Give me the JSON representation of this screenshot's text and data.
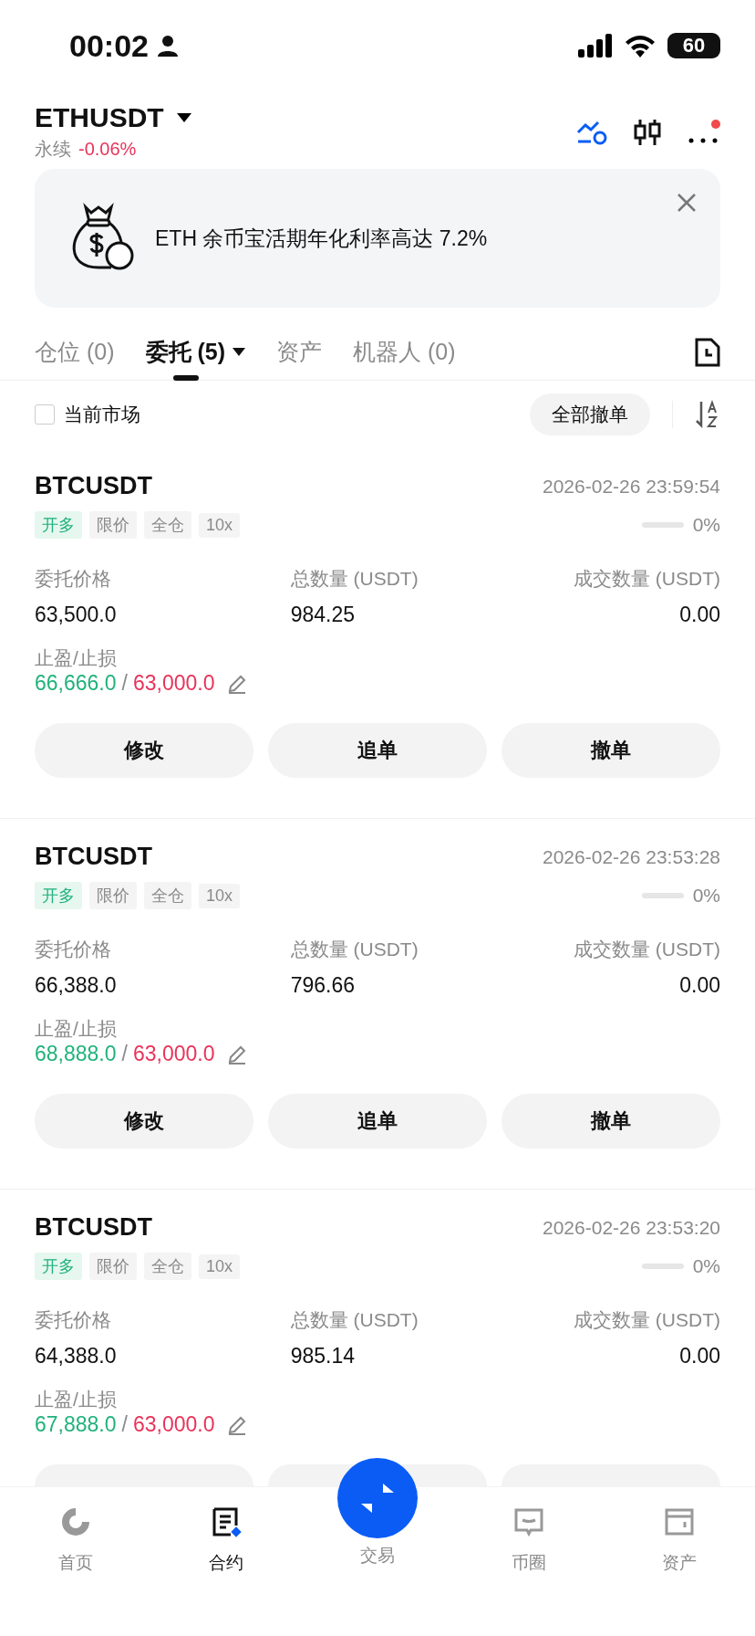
{
  "status_bar": {
    "time": "00:02",
    "battery": "60"
  },
  "header": {
    "symbol": "ETHUSDT",
    "type": "永续",
    "change": "-0.06%",
    "notification_dot": true
  },
  "banner": {
    "text": "ETH 余币宝活期年化利率高达 7.2%"
  },
  "tabs": [
    {
      "label": "仓位 (0)",
      "selected": false,
      "dropdown": false
    },
    {
      "label": "委托 (5)",
      "selected": true,
      "dropdown": true
    },
    {
      "label": "资产",
      "selected": false,
      "dropdown": false
    },
    {
      "label": "机器人 (0)",
      "selected": false,
      "dropdown": false
    }
  ],
  "filter": {
    "label": "当前市场",
    "checked": false,
    "cancel_all": "全部撤单"
  },
  "orders": [
    {
      "symbol": "BTCUSDT",
      "time": "2026-02-26 23:59:54",
      "tags": [
        {
          "label": "开多",
          "kind": "side"
        },
        {
          "label": "限价",
          "kind": "plain"
        },
        {
          "label": "全仓",
          "kind": "plain"
        },
        {
          "label": "10x",
          "kind": "plain"
        }
      ],
      "level": 0,
      "progress": "0%",
      "fields": [
        {
          "label": "委托价格",
          "value": "63,500.0"
        },
        {
          "label": "总数量 (USDT)",
          "value": "984.25"
        },
        {
          "label": "成交数量 (USDT)",
          "value": "0.00"
        }
      ],
      "tpsl_label": "止盈/止损",
      "tp": "66,666.0",
      "separator": "/",
      "sl": "63,000.0",
      "actions": [
        "修改",
        "追单",
        "撤单"
      ]
    },
    {
      "symbol": "BTCUSDT",
      "time": "2026-02-26 23:53:28",
      "tags": [
        {
          "label": "开多",
          "kind": "side"
        },
        {
          "label": "限价",
          "kind": "plain"
        },
        {
          "label": "全仓",
          "kind": "plain"
        },
        {
          "label": "10x",
          "kind": "plain"
        }
      ],
      "level": 0,
      "progress": "0%",
      "fields": [
        {
          "label": "委托价格",
          "value": "66,388.0"
        },
        {
          "label": "总数量 (USDT)",
          "value": "796.66"
        },
        {
          "label": "成交数量 (USDT)",
          "value": "0.00"
        }
      ],
      "tpsl_label": "止盈/止损",
      "tp": "68,888.0",
      "separator": "/",
      "sl": "63,000.0",
      "actions": [
        "修改",
        "追单",
        "撤单"
      ]
    },
    {
      "symbol": "BTCUSDT",
      "time": "2026-02-26 23:53:20",
      "tags": [
        {
          "label": "开多",
          "kind": "side"
        },
        {
          "label": "限价",
          "kind": "plain"
        },
        {
          "label": "全仓",
          "kind": "plain"
        },
        {
          "label": "10x",
          "kind": "plain"
        }
      ],
      "level": 0,
      "progress": "0%",
      "fields": [
        {
          "label": "委托价格",
          "value": "64,388.0"
        },
        {
          "label": "总数量 (USDT)",
          "value": "985.14"
        },
        {
          "label": "成交数量 (USDT)",
          "value": "0.00"
        }
      ],
      "tpsl_label": "止盈/止损",
      "tp": "67,888.0",
      "separator": "/",
      "sl": "63,000.0"
    }
  ],
  "nav": [
    {
      "label": "首页",
      "kind": "home",
      "selected": false
    },
    {
      "label": "合约",
      "kind": "contract",
      "selected": true
    },
    {
      "label": "交易",
      "kind": "trade",
      "selected": false
    },
    {
      "label": "币圈",
      "kind": "feed",
      "selected": false
    },
    {
      "label": "资产",
      "kind": "wallet",
      "selected": false
    }
  ]
}
